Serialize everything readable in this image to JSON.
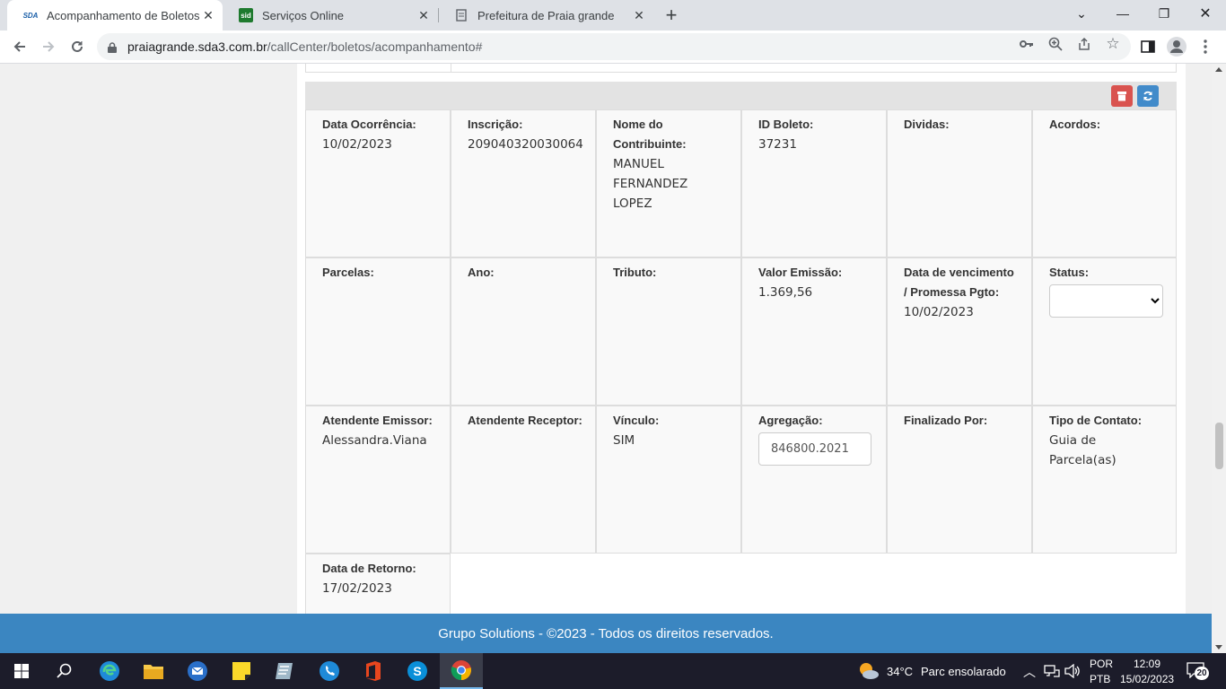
{
  "browser": {
    "tabs": [
      {
        "title": "Acompanhamento de Boletos / P",
        "favicon": "sda-logo",
        "active": true
      },
      {
        "title": "Serviços Online",
        "favicon": "sid-logo",
        "active": false
      },
      {
        "title": "Prefeitura de Praia grande",
        "favicon": "page-icon",
        "active": false
      }
    ],
    "url_host": "praiagrande.sda3.com.br",
    "url_path": "/callCenter/boletos/acompanhamento#"
  },
  "record": {
    "row1": [
      {
        "label": "Data Ocorrência:",
        "value": "10/02/2023"
      },
      {
        "label": "Inscrição:",
        "value": "209040320030064"
      },
      {
        "label": "Nome do Contribuinte:",
        "value": "MANUEL FERNANDEZ LOPEZ"
      },
      {
        "label": "ID Boleto:",
        "value": "37231"
      },
      {
        "label": "Dividas:",
        "value": ""
      },
      {
        "label": "Acordos:",
        "value": ""
      }
    ],
    "row2": [
      {
        "label": "Parcelas:",
        "value": ""
      },
      {
        "label": "Ano:",
        "value": ""
      },
      {
        "label": "Tributo:",
        "value": ""
      },
      {
        "label": "Valor Emissão:",
        "value": "1.369,56"
      },
      {
        "label": "Data de vencimento / Promessa Pgto:",
        "value": "10/02/2023"
      },
      {
        "label": "Status:",
        "select_value": ""
      }
    ],
    "row3": [
      {
        "label": "Atendente Emissor:",
        "value": "Alessandra.Viana"
      },
      {
        "label": "Atendente Receptor:",
        "value": ""
      },
      {
        "label": "Vínculo:",
        "value": "SIM"
      },
      {
        "label": "Agregação:",
        "input_value": "846800.2021"
      },
      {
        "label": "Finalizado Por:",
        "value": ""
      },
      {
        "label": "Tipo de Contato:",
        "value": "Guia de Parcela(as)"
      }
    ],
    "row4": [
      {
        "label": "Data de Retorno:",
        "value": "17/02/2023"
      }
    ]
  },
  "footer": {
    "text": "Grupo Solutions - ©2023 - Todos os direitos reservados."
  },
  "taskbar": {
    "weather_temp": "34°C",
    "weather_text": "Parc ensolarado",
    "lang_top": "POR",
    "lang_bottom": "PTB",
    "time": "12:09",
    "date": "15/02/2023",
    "notifications": "20"
  },
  "colors": {
    "footer": "#3b86c1",
    "delete_button": "#d9534f",
    "refresh_button": "#428bca"
  }
}
